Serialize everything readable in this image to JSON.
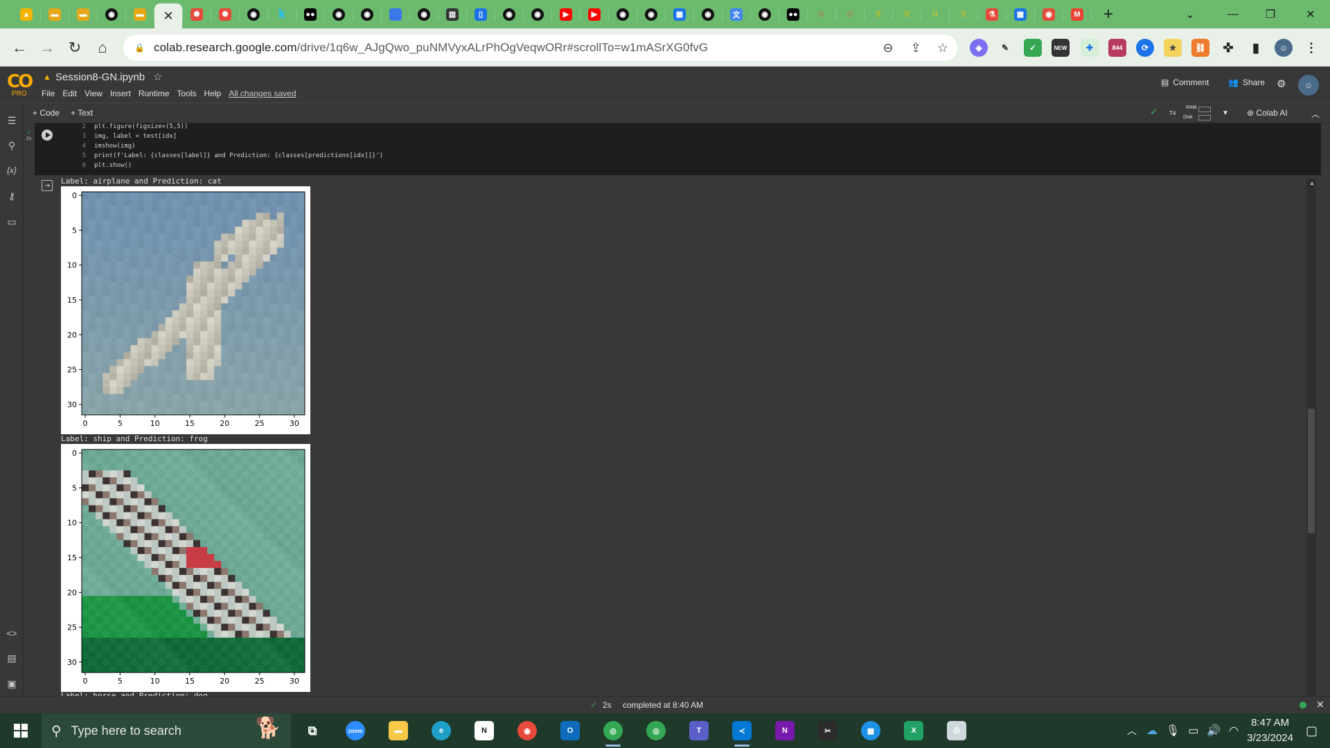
{
  "browser": {
    "tabs": [
      {
        "icon": "google-drive-icon",
        "color": "#f4b400"
      },
      {
        "icon": "folder-icon",
        "color": "#e6a817"
      },
      {
        "icon": "folder-icon",
        "color": "#e6a817"
      },
      {
        "icon": "github-icon",
        "color": "#111111"
      },
      {
        "icon": "folder-icon",
        "color": "#e6a817"
      },
      {
        "icon": "close-icon",
        "color": "#222222",
        "active": true
      },
      {
        "icon": "pinwheel-icon",
        "color": "#e64a3b"
      },
      {
        "icon": "pinwheel-icon",
        "color": "#e64a3b"
      },
      {
        "icon": "github-icon",
        "color": "#111111"
      },
      {
        "icon": "kaggle-icon",
        "color": "#20beff"
      },
      {
        "icon": "medium-icon",
        "color": "#000000"
      },
      {
        "icon": "github-icon",
        "color": "#111111"
      },
      {
        "icon": "github-icon",
        "color": "#111111"
      },
      {
        "icon": "blue-square-icon",
        "color": "#3b78e7"
      },
      {
        "icon": "github-icon",
        "color": "#111111"
      },
      {
        "icon": "grid-icon",
        "color": "#333333"
      },
      {
        "icon": "doc-icon",
        "color": "#1a73e8"
      },
      {
        "icon": "github-icon",
        "color": "#111111"
      },
      {
        "icon": "github-icon",
        "color": "#111111"
      },
      {
        "icon": "youtube-icon",
        "color": "#ff0000"
      },
      {
        "icon": "youtube-icon",
        "color": "#ff0000"
      },
      {
        "icon": "github-icon",
        "color": "#111111"
      },
      {
        "icon": "github-icon",
        "color": "#111111"
      },
      {
        "icon": "calendar-icon",
        "color": "#1a73e8"
      },
      {
        "icon": "github-icon",
        "color": "#111111"
      },
      {
        "icon": "translate-icon",
        "color": "#4285f4"
      },
      {
        "icon": "github-icon",
        "color": "#111111"
      },
      {
        "icon": "medium-icon",
        "color": "#000000"
      },
      {
        "icon": "circle-icon",
        "color": "#e64a3b"
      },
      {
        "icon": "circle-icon",
        "color": "#e64a3b"
      },
      {
        "icon": "dots-icon",
        "color": "#f2c400"
      },
      {
        "icon": "dots-icon",
        "color": "#f2c400"
      },
      {
        "icon": "dots-icon",
        "color": "#f2c400"
      },
      {
        "icon": "dots-icon",
        "color": "#f2c400"
      },
      {
        "icon": "flask-icon",
        "color": "#e64a3b"
      },
      {
        "icon": "calendar-icon",
        "color": "#1a73e8"
      },
      {
        "icon": "record-icon",
        "color": "#e64a3b"
      },
      {
        "icon": "gmail-icon",
        "color": "#ea4335"
      }
    ],
    "calendar_tab_text": "19",
    "calendar_tab_text_2": "23",
    "url_host": "colab.research.google.com",
    "url_path": "/drive/1q6w_AJgQwo_puNMVyxALrPhOgVeqwORr#scrollTo=w1mASrXG0fvG",
    "extension_badge": "844",
    "extension_new_label": "NEW"
  },
  "colab": {
    "logo_text": "CO",
    "pro_label": "PRO",
    "notebook_name": "Session8-GN.ipynb",
    "menu": [
      "File",
      "Edit",
      "View",
      "Insert",
      "Runtime",
      "Tools",
      "Help"
    ],
    "saved_status": "All changes saved",
    "comment_label": "Comment",
    "share_label": "Share",
    "add_code_label": "+ Code",
    "add_text_label": "+ Text",
    "runtime_type": "T4",
    "ram_label": "RAM",
    "disk_label": "Disk",
    "colab_ai_label": "Colab AI"
  },
  "code_cell": {
    "exec_time": "2s",
    "lines": [
      {
        "n": "2",
        "text": "plt.figure(figsize=(5,5))"
      },
      {
        "n": "3",
        "text": "img, label = test[idx]"
      },
      {
        "n": "4",
        "text": "imshow(img)"
      },
      {
        "n": "5",
        "text": "print(f'Label: {classes[label]} and Prediction: {classes[predictions[idx]]}')"
      },
      {
        "n": "6",
        "text": "plt.show()"
      }
    ]
  },
  "outputs": [
    {
      "label": "Label: airplane and Prediction: cat"
    },
    {
      "label": "Label: ship and Prediction: frog"
    },
    {
      "label": "Label: horse and Prediction: dog"
    }
  ],
  "plot_axes": {
    "x_ticks": [
      "0",
      "5",
      "10",
      "15",
      "20",
      "25",
      "30"
    ],
    "y_ticks": [
      "0",
      "5",
      "10",
      "15",
      "20",
      "25",
      "30"
    ]
  },
  "statusbar": {
    "exec_time": "2s",
    "completed_text": "completed at 8:40 AM"
  },
  "taskbar": {
    "search_placeholder": "Type here to search",
    "time": "8:47 AM",
    "date": "3/23/2024",
    "apps": [
      {
        "icon": "task-view-icon",
        "color": "#1f3a2a"
      },
      {
        "icon": "zoom-icon",
        "color": "#2d8cff",
        "text": "zoom"
      },
      {
        "icon": "file-explorer-icon",
        "color": "#f7c948"
      },
      {
        "icon": "edge-icon",
        "color": "#1ea0c8"
      },
      {
        "icon": "notion-icon",
        "color": "#ffffff"
      },
      {
        "icon": "recorder-icon",
        "color": "#e64a3b"
      },
      {
        "icon": "outlook-icon",
        "color": "#0f6cbd"
      },
      {
        "icon": "chrome-icon",
        "color": "#34a853",
        "active": true
      },
      {
        "icon": "chrome-icon",
        "color": "#34a853"
      },
      {
        "icon": "teams-icon",
        "color": "#5b5fc7"
      },
      {
        "icon": "vscode-icon",
        "color": "#0078d4",
        "active": true
      },
      {
        "icon": "onenote-icon",
        "color": "#7719aa"
      },
      {
        "icon": "snipping-icon",
        "color": "#2b2b2b"
      },
      {
        "icon": "docker-icon",
        "color": "#1d91e6"
      },
      {
        "icon": "excel-icon",
        "color": "#21a366"
      },
      {
        "icon": "printer-icon",
        "color": "#cfd8dc"
      }
    ]
  }
}
